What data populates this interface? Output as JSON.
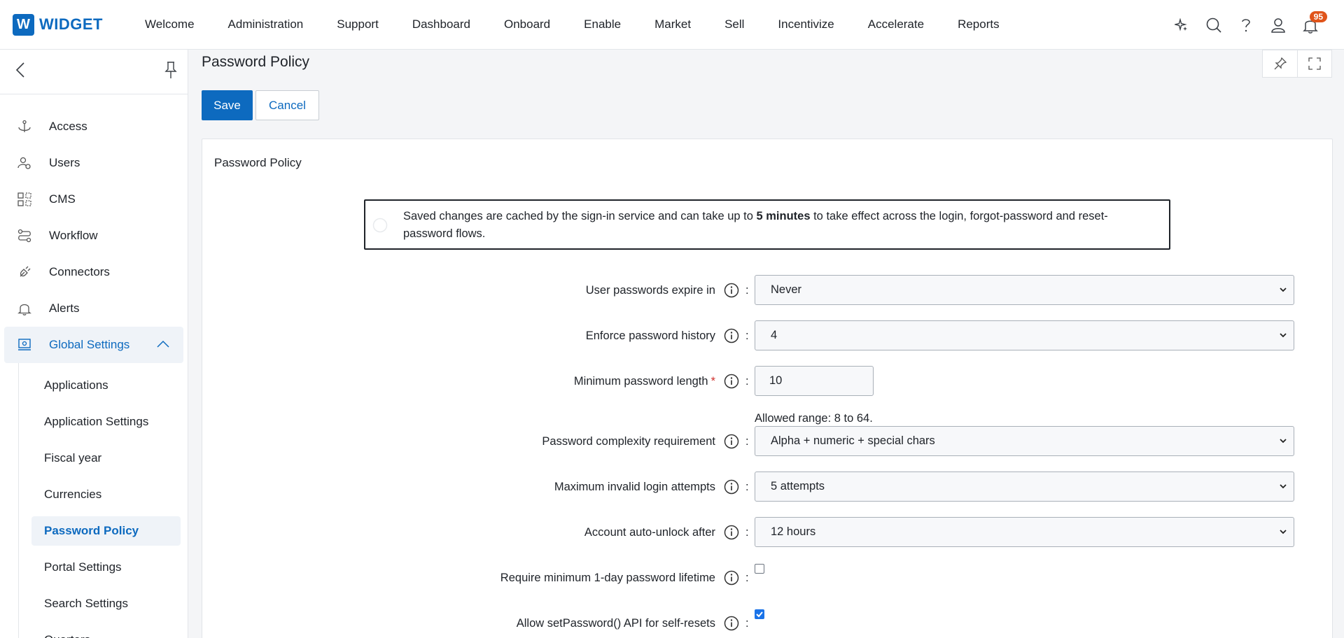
{
  "app": {
    "logo_letter": "W",
    "logo_text": "WIDGET"
  },
  "nav": [
    "Welcome",
    "Administration",
    "Support",
    "Dashboard",
    "Onboard",
    "Enable",
    "Market",
    "Sell",
    "Incentivize",
    "Accelerate",
    "Reports"
  ],
  "top_icons": {
    "notification_count": "95"
  },
  "sidebar": {
    "items": [
      "Access",
      "Users",
      "CMS",
      "Workflow",
      "Connectors",
      "Alerts"
    ],
    "active_group": "Global Settings",
    "sub_items": [
      "Applications",
      "Application Settings",
      "Fiscal year",
      "Currencies",
      "Password Policy",
      "Portal Settings",
      "Search Settings",
      "Quarters"
    ]
  },
  "page": {
    "title": "Password Policy",
    "save_label": "Save",
    "cancel_label": "Cancel",
    "card_title": "Password Policy",
    "notice_pre": "Saved changes are cached by the sign-in service and can take up to ",
    "notice_bold": "5 minutes",
    "notice_post": " to take effect across the login, forgot-password and reset-password flows."
  },
  "form": {
    "expire_label": "User passwords expire in",
    "expire_value": "Never",
    "history_label": "Enforce password history",
    "history_value": "4",
    "minlen_label": "Minimum password length",
    "minlen_required": "*",
    "minlen_value": "10",
    "minlen_hint": "Allowed range: 8 to 64.",
    "complexity_label": "Password complexity requirement",
    "complexity_value": "Alpha + numeric + special chars",
    "attempts_label": "Maximum invalid login attempts",
    "attempts_value": "5 attempts",
    "unlock_label": "Account auto-unlock after",
    "unlock_value": "12 hours",
    "lifetime_label": "Require minimum 1-day password lifetime",
    "lifetime_checked": false,
    "api_label": "Allow setPassword() API for self-resets",
    "api_checked": true,
    "colon": ":"
  },
  "colors": {
    "accent": "#0d6abf",
    "required": "#d0312d",
    "badge": "#e0541a"
  }
}
